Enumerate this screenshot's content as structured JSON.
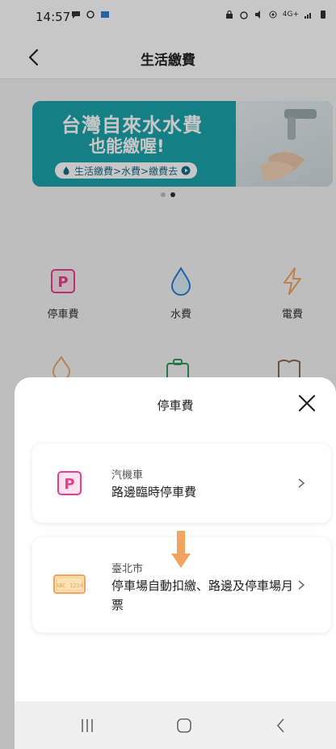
{
  "status_bar": {
    "time": "14:57",
    "network_text": "4G+"
  },
  "header": {
    "title": "生活繳費"
  },
  "banner": {
    "line1": "台灣自來水水費",
    "line2": "也能繳喔!",
    "link": "生活繳費>水費>繳費去"
  },
  "services": [
    {
      "label": "停車費",
      "icon": "parking-icon"
    },
    {
      "label": "水費",
      "icon": "water-drop-icon"
    },
    {
      "label": "電費",
      "icon": "lightning-icon"
    }
  ],
  "sheet": {
    "title": "停車費",
    "options": [
      {
        "subtitle": "汽機車",
        "title": "路邊臨時停車費",
        "icon": "parking-icon"
      },
      {
        "subtitle": "臺北市",
        "title": "停車場自動扣繳、路邊及停車場月票",
        "icon": "license-plate-icon",
        "plate_text": "ABC 1234"
      }
    ]
  },
  "colors": {
    "accent_pink": "#e6408f",
    "accent_orange": "#f0a460",
    "banner_teal": "#1aa3a9"
  }
}
